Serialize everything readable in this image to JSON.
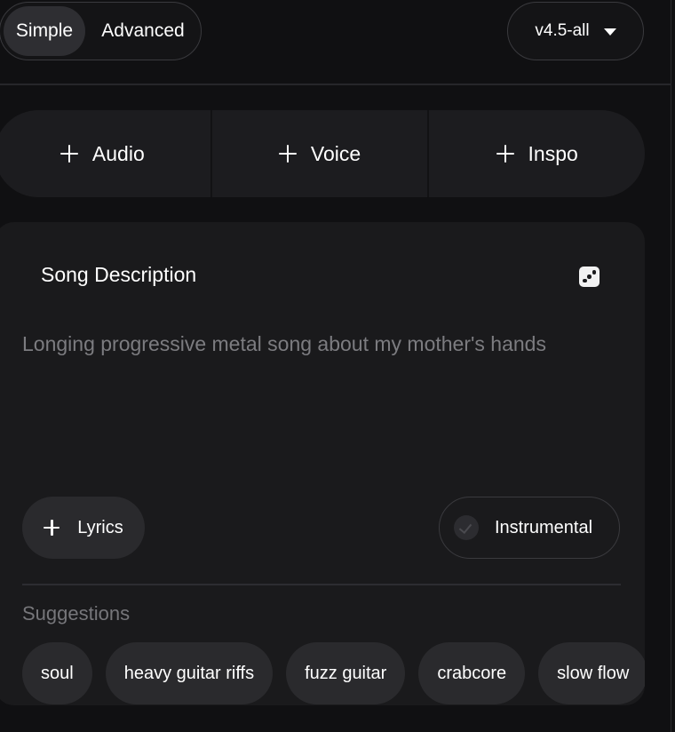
{
  "mode_toggle": {
    "simple_label": "Simple",
    "advanced_label": "Advanced",
    "selected": "Simple"
  },
  "version": {
    "label": "v4.5-all"
  },
  "add_buttons": {
    "audio_label": "Audio",
    "voice_label": "Voice",
    "inspo_label": "Inspo"
  },
  "description": {
    "title": "Song Description",
    "placeholder": "Longing progressive metal song about my mother's hands",
    "value": ""
  },
  "lyrics_button": {
    "label": "Lyrics"
  },
  "instrumental_toggle": {
    "label": "Instrumental",
    "checked": false
  },
  "suggestions": {
    "label": "Suggestions",
    "items": [
      "soul",
      "heavy guitar riffs",
      "fuzz guitar",
      "crabcore",
      "slow flow"
    ]
  },
  "colors": {
    "background": "#101012",
    "card": "#1a1a1c",
    "chip": "#2a2a2d",
    "muted_text": "#7c7c80"
  }
}
